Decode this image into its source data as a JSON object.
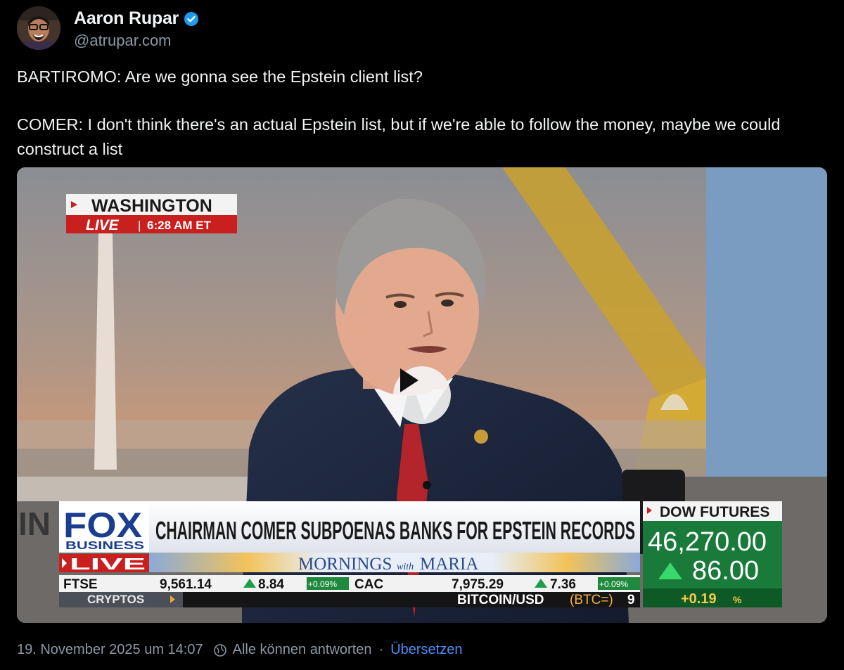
{
  "post": {
    "author_name": "Aaron Rupar",
    "author_handle": "@atrupar.com",
    "text_lines": [
      "BARTIROMO: Are we gonna see the Epstein client list?",
      "COMER: I don't think there's an actual Epstein list, but if we're able to follow the money, maybe we could construct a list"
    ],
    "timestamp": "19. November 2025 um 14:07",
    "reply_setting": "Alle können antworten",
    "separator": "·",
    "translate_label": "Übersetzen"
  },
  "video": {
    "location": "WASHINGTON",
    "live_label": "LIVE",
    "time": "6:28 AM ET",
    "network": "FOX",
    "network_sub": "BUSINESS",
    "network_live": "LIVE",
    "headline": "CHAIRMAN COMER SUBPOENAS BANKS FOR EPSTEIN RECORDS",
    "show_name": "MORNINGS",
    "show_with": "with",
    "show_host": "MARIA",
    "dow_label": "DOW FUTURES",
    "dow_value": "46,270.00",
    "dow_change": "86.00",
    "dow_percent": "+0.19",
    "dow_percent_sign": "%",
    "ticker": [
      {
        "name": "FTSE",
        "value": "9,561.14",
        "change": "8.84",
        "pct": "+0.09%"
      },
      {
        "name": "CAC",
        "value": "7,975.29",
        "change": "7.36",
        "pct": "+0.09%"
      }
    ],
    "crypto_label": "CRYPTOS",
    "crypto_pair": "BITCOIN/USD",
    "crypto_code": "(BTC=)",
    "crypto_digit": "9",
    "left_edge_text": "IN"
  },
  "colors": {
    "verified_blue": "#1d9bf0",
    "link_blue": "#4d8ef7",
    "fox_red": "#c8201f",
    "fox_blue": "#1b3d8f",
    "green": "#1a7a3a"
  }
}
